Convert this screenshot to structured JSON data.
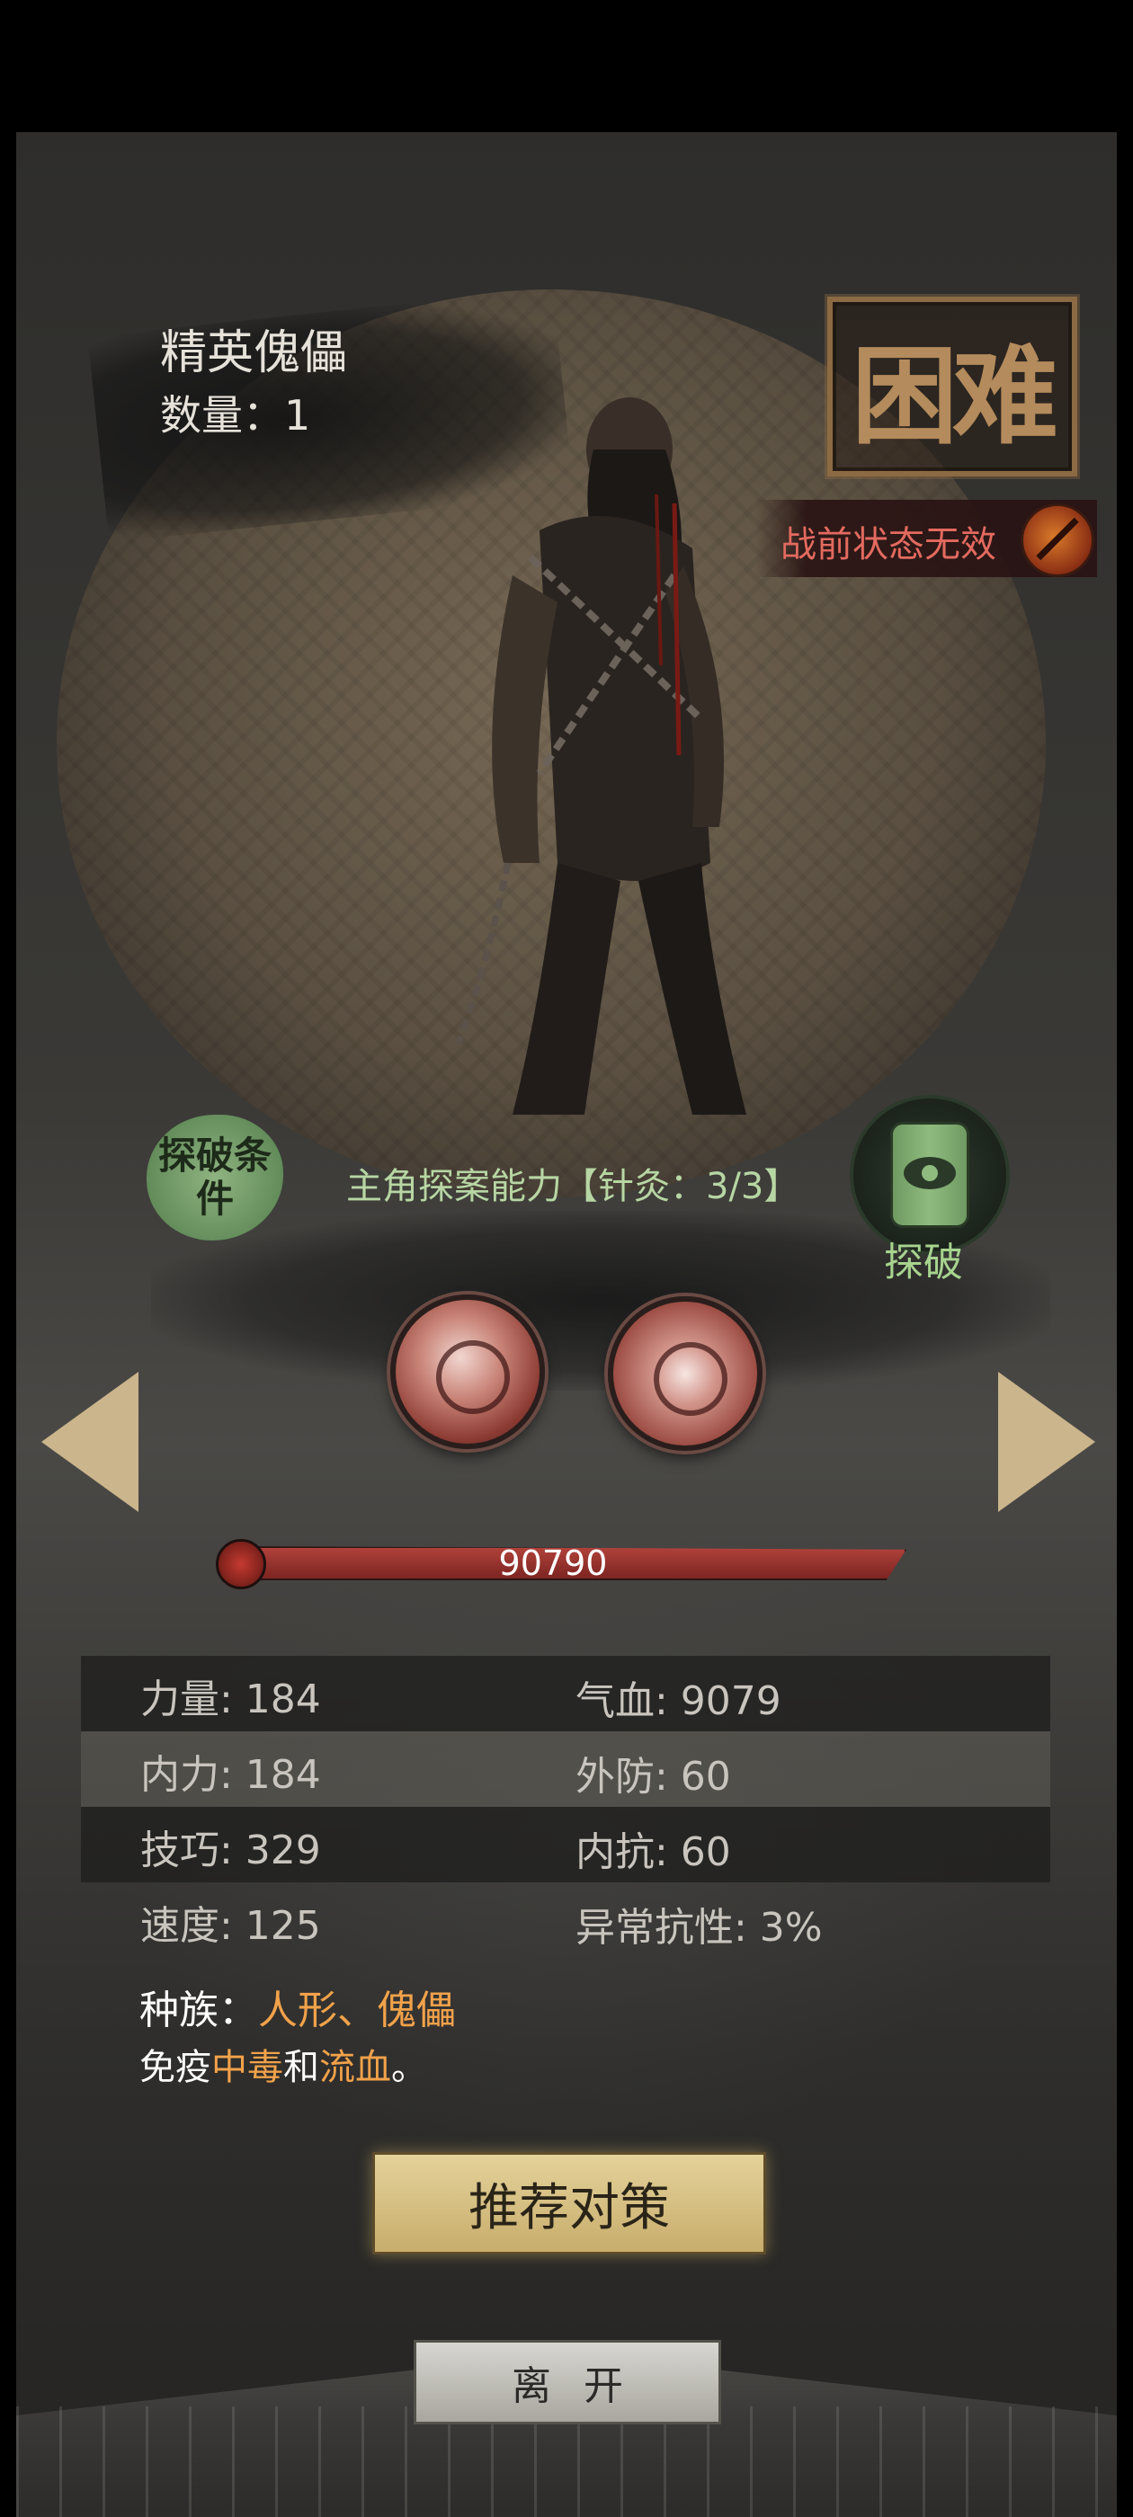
{
  "enemy": {
    "name": "精英傀儡",
    "count_label": "数量：1",
    "difficulty": "困难",
    "battle_status": "战前状态无效"
  },
  "reveal": {
    "condition_badge": "探破条件",
    "condition_text": "主角探案能力【针灸：3/3】",
    "button_label": "探破"
  },
  "hp": {
    "value": "90790"
  },
  "stats": {
    "rows": [
      {
        "left": "力量: 184",
        "right": "气血: 9079"
      },
      {
        "left": "内力: 184",
        "right": "外防: 60"
      },
      {
        "left": "技巧: 329",
        "right": "内抗: 60"
      },
      {
        "left": "速度: 125",
        "right": "异常抗性: 3%"
      }
    ]
  },
  "traits": {
    "race_label": "种族：",
    "race_value": "人形、傀儡",
    "immune_prefix": "免疫",
    "immune_a": "中毒",
    "immune_join": "和",
    "immune_b": "流血",
    "immune_suffix": "。"
  },
  "buttons": {
    "strategy": "推荐对策",
    "leave": "离开"
  },
  "colors": {
    "accent_orange": "#f2a24a",
    "reveal_green": "#a7d48f",
    "status_red": "#e36a5f",
    "hp_red": "#b0413a"
  }
}
